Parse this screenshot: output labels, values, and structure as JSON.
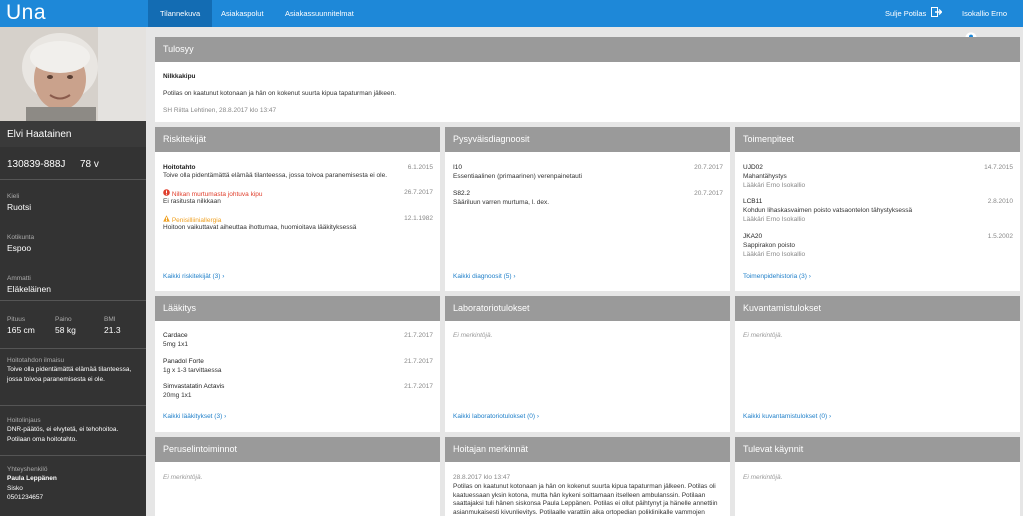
{
  "app": {
    "logo": "Una"
  },
  "nav": {
    "tabs": [
      "Tilannekuva",
      "Asiakaspolut",
      "Asiakassuunnitelmat"
    ],
    "close_patient": "Sulje Potilas",
    "user": "Isokallio Erno"
  },
  "patient": {
    "name": "Elvi Haatainen",
    "id": "130839-888J",
    "age": "78 v",
    "language_label": "Kieli",
    "language": "Ruotsi",
    "municipality_label": "Kotikunta",
    "municipality": "Espoo",
    "profession_label": "Ammatti",
    "profession": "Eläkeläinen",
    "height_label": "Pituus",
    "height": "165 cm",
    "weight_label": "Paino",
    "weight": "58 kg",
    "bmi_label": "BMI",
    "bmi": "21.3",
    "care_will_label": "Hoitotahdon ilmaisu",
    "care_will": "Toive olla pidentämättä elämää tilanteessa, jossa toivoa paranemisesta ei ole.",
    "care_policy_label": "Hoitolinjaus",
    "care_policy": "DNR-päätös, ei elvytetä, ei tehohoitoa. Potilaan oma hoitotahto.",
    "contact_label": "Yhteyshenkilö",
    "contact_name": "Paula Leppänen",
    "contact_relation": "Sisko",
    "contact_phone": "0501234657"
  },
  "tulosyy": {
    "header": "Tulosyy",
    "title": "Nilkkakipu",
    "text": "Potilas on kaatunut kotonaan ja hän on kokenut suurta kipua tapaturman jälkeen.",
    "meta": "SH Riitta Lehtinen, 28.8.2017 klo 13:47"
  },
  "riskitekijat": {
    "header": "Riskitekijät",
    "items": [
      {
        "title": "Hoitotahto",
        "date": "6.1.2015",
        "text": "Toive olla pidentämättä elämää tilanteessa, jossa toivoa paranemisesta ei ole."
      },
      {
        "title": "Nilkan murtumasta johtuva kipu",
        "date": "26.7.2017",
        "text": "Ei rasitusta nilkkaan"
      },
      {
        "title": "Penisilliiniallergia",
        "date": "12.1.1982",
        "text": "Hoitoon vaikuttavat aiheuttaa ihottumaa, huomioitava lääkityksessä"
      }
    ],
    "link": "Kaikki riskitekijät (3)"
  },
  "diagnoosit": {
    "header": "Pysyväisdiagnoosit",
    "items": [
      {
        "code": "I10",
        "date": "20.7.2017",
        "text": "Essentiaalinen (primaarinen) verenpainetauti"
      },
      {
        "code": "S82.2",
        "date": "20.7.2017",
        "text": "Sääriluun varren murtuma, l. dex."
      }
    ],
    "link": "Kaikki diagnoosit (5)"
  },
  "toimenpiteet": {
    "header": "Toimenpiteet",
    "items": [
      {
        "code": "UJD02",
        "date": "14.7.2015",
        "text": "Mahantähystys",
        "doctor": "Lääkäri Erno Isokallio"
      },
      {
        "code": "LCB11",
        "date": "2.8.2010",
        "text": "Kohdun lihaskasvaimen poisto vatsaontelon tähystyksessä",
        "doctor": "Lääkäri Erno Isokallio"
      },
      {
        "code": "JKA20",
        "date": "1.5.2002",
        "text": "Sappirakon poisto",
        "doctor": "Lääkäri Erno Isokallio"
      }
    ],
    "link": "Toimenpidehistoria (3)"
  },
  "laakitys": {
    "header": "Lääkitys",
    "items": [
      {
        "title": "Cardace",
        "date": "21.7.2017",
        "text": "5mg 1x1"
      },
      {
        "title": "Panadol Forte",
        "date": "21.7.2017",
        "text": "1g x 1-3 tarvittaessa"
      },
      {
        "title": "Simvastatatin Actavis",
        "date": "21.7.2017",
        "text": "20mg 1x1"
      }
    ],
    "link": "Kaikki lääkitykset (3)"
  },
  "laboratorio": {
    "header": "Laboratoriotulokset",
    "empty": "Ei merkintöjä.",
    "link": "Kaikki laboratoriotulokset (0)"
  },
  "kuvantaminen": {
    "header": "Kuvantamistulokset",
    "empty": "Ei merkintöjä.",
    "link": "Kaikki kuvantamistulokset (0)"
  },
  "perus": {
    "header": "Peruselintoiminnot",
    "empty": "Ei merkintöjä."
  },
  "hoitaja": {
    "header": "Hoitajan merkinnät",
    "meta": "28.8.2017 klo 13:47",
    "text": "Potilas on kaatunut kotonaan ja hän on kokenut suurta kipua tapaturman jälkeen. Potilas oli kaatuessaan yksin kotona, mutta hän kykeni soittamaan itselleen ambulanssin. Potilaan saattajaksi tuli hänen siskonsa Paula Leppänen. Potilas ei ollut päihtynyt ja hänelle annettiin asianmukaisesti kivunlievitys. Potilaalle varattiin aika ortopedian poliklinikalle vammojen"
  },
  "tulevat": {
    "header": "Tulevat käynnit",
    "empty": "Ei merkintöjä."
  },
  "colors": {
    "brand": "#1e88d8",
    "sidebar": "#333333",
    "panel_header": "#9a9a9a",
    "link": "#1e7fc9"
  }
}
